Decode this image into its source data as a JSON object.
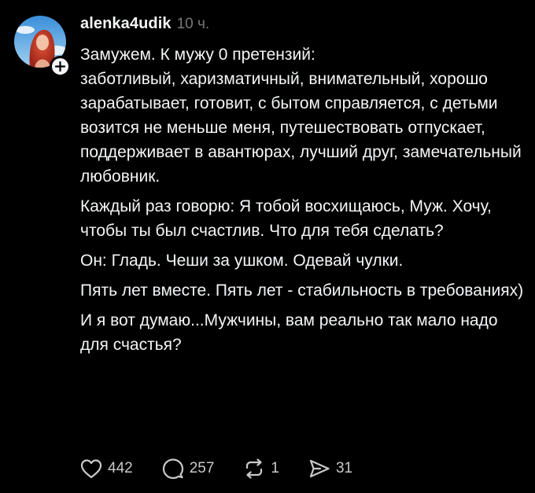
{
  "post": {
    "author": {
      "username": "alenka4udik",
      "timestamp": "10 ч.",
      "avatar_icon": "profile-photo",
      "follow_icon": "plus-icon"
    },
    "paragraphs": [
      "Замужем. К мужу 0 претензий:\nзаботливый, харизматичный, внимательный, хорошо зарабатывает, готовит, с бытом справляется, с детьми возится не меньше меня, путешествовать отпускает, поддерживает в авантюрах, лучший друг, замечательный любовник.",
      "Каждый раз говорю: Я тобой восхищаюсь, Муж. Хочу, чтобы ты был счастлив. Что для тебя сделать?",
      "Он: Гладь. Чеши за ушком. Одевай чулки.",
      "Пять лет вместе. Пять лет - стабильность в требованиях)",
      "И я вот думаю...Мужчины, вам реально так мало надо для счастья?"
    ],
    "actions": {
      "likes": "442",
      "replies": "257",
      "reposts": "1",
      "shares": "31"
    }
  },
  "colors": {
    "background": "#000000",
    "text": "#f3f5f7",
    "muted": "#777777",
    "action": "#c9c9c9"
  }
}
